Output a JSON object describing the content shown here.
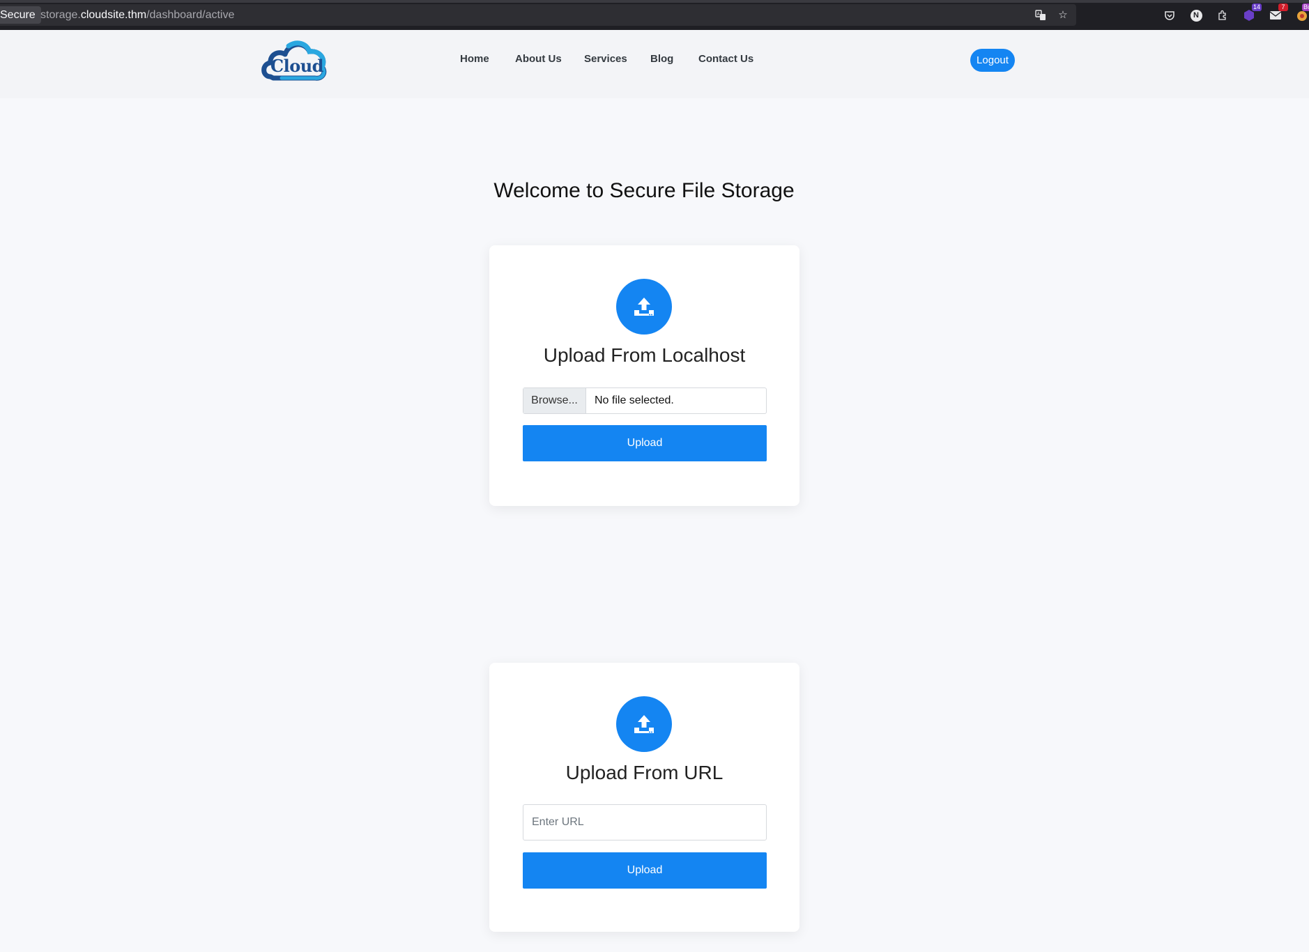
{
  "browser": {
    "secure_label": "Secure",
    "url_prefix": "storage.",
    "url_host": "cloudsite.thm",
    "url_path": "/dashboard/active",
    "ext_badge_1": "14",
    "ext_badge_2": "7",
    "ext_badge_3": "Bur",
    "n_label": "N"
  },
  "header": {
    "logo_text": "Cloud",
    "nav": {
      "home": "Home",
      "about": "About Us",
      "services": "Services",
      "blog": "Blog",
      "contact": "Contact Us"
    },
    "logout_label": "Logout"
  },
  "main": {
    "title": "Welcome to Secure File Storage",
    "local_card": {
      "title": "Upload From Localhost",
      "browse_label": "Browse...",
      "file_status": "No file selected.",
      "upload_label": "Upload"
    },
    "url_card": {
      "title": "Upload From URL",
      "url_placeholder": "Enter URL",
      "url_value": "",
      "upload_label": "Upload"
    }
  },
  "colors": {
    "accent": "#1485f2",
    "logo_dark": "#1d4f91",
    "logo_light": "#2aa7e0"
  }
}
